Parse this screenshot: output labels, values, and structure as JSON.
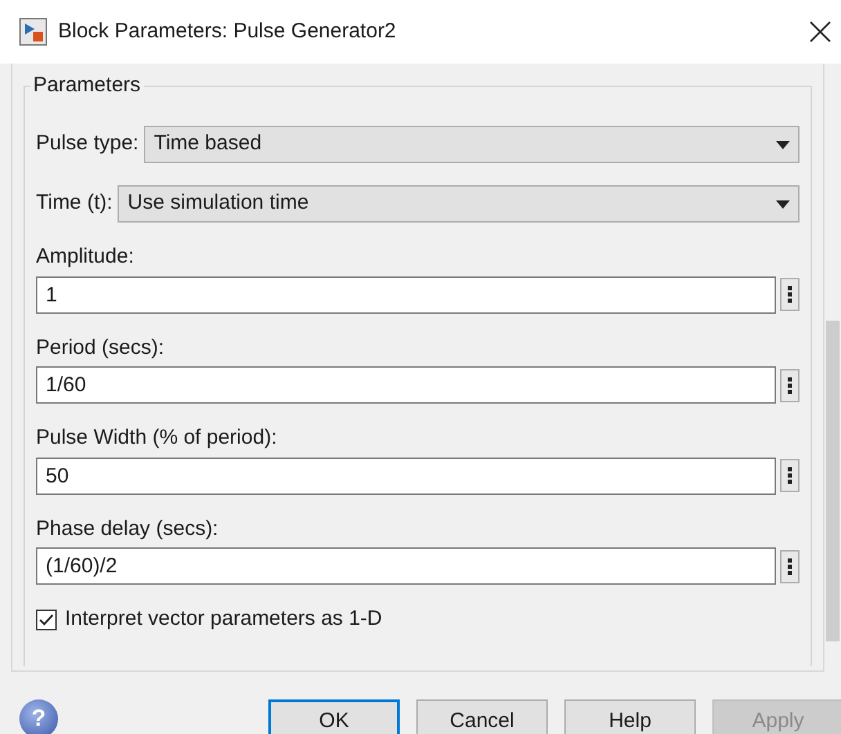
{
  "window": {
    "title": "Block Parameters: Pulse Generator2"
  },
  "group": {
    "title": "Parameters"
  },
  "dropdowns": [
    {
      "label": "Pulse type:",
      "value": "Time based"
    },
    {
      "label": "Time (t):",
      "value": "Use simulation time"
    }
  ],
  "fields": [
    {
      "label": "Amplitude:",
      "value": "1"
    },
    {
      "label": "Period (secs):",
      "value": "1/60"
    },
    {
      "label": "Pulse Width (% of period):",
      "value": "50"
    },
    {
      "label": "Phase delay (secs):",
      "value": "(1/60)/2"
    }
  ],
  "checkbox": {
    "label": "Interpret vector parameters as 1-D",
    "checked": true
  },
  "help": {
    "symbol": "?"
  },
  "buttons": [
    {
      "label": "OK",
      "kind": "default",
      "disabled": false
    },
    {
      "label": "Cancel",
      "kind": "normal",
      "disabled": false
    },
    {
      "label": "Help",
      "kind": "normal",
      "disabled": false
    },
    {
      "label": "Apply",
      "kind": "normal",
      "disabled": true
    }
  ]
}
